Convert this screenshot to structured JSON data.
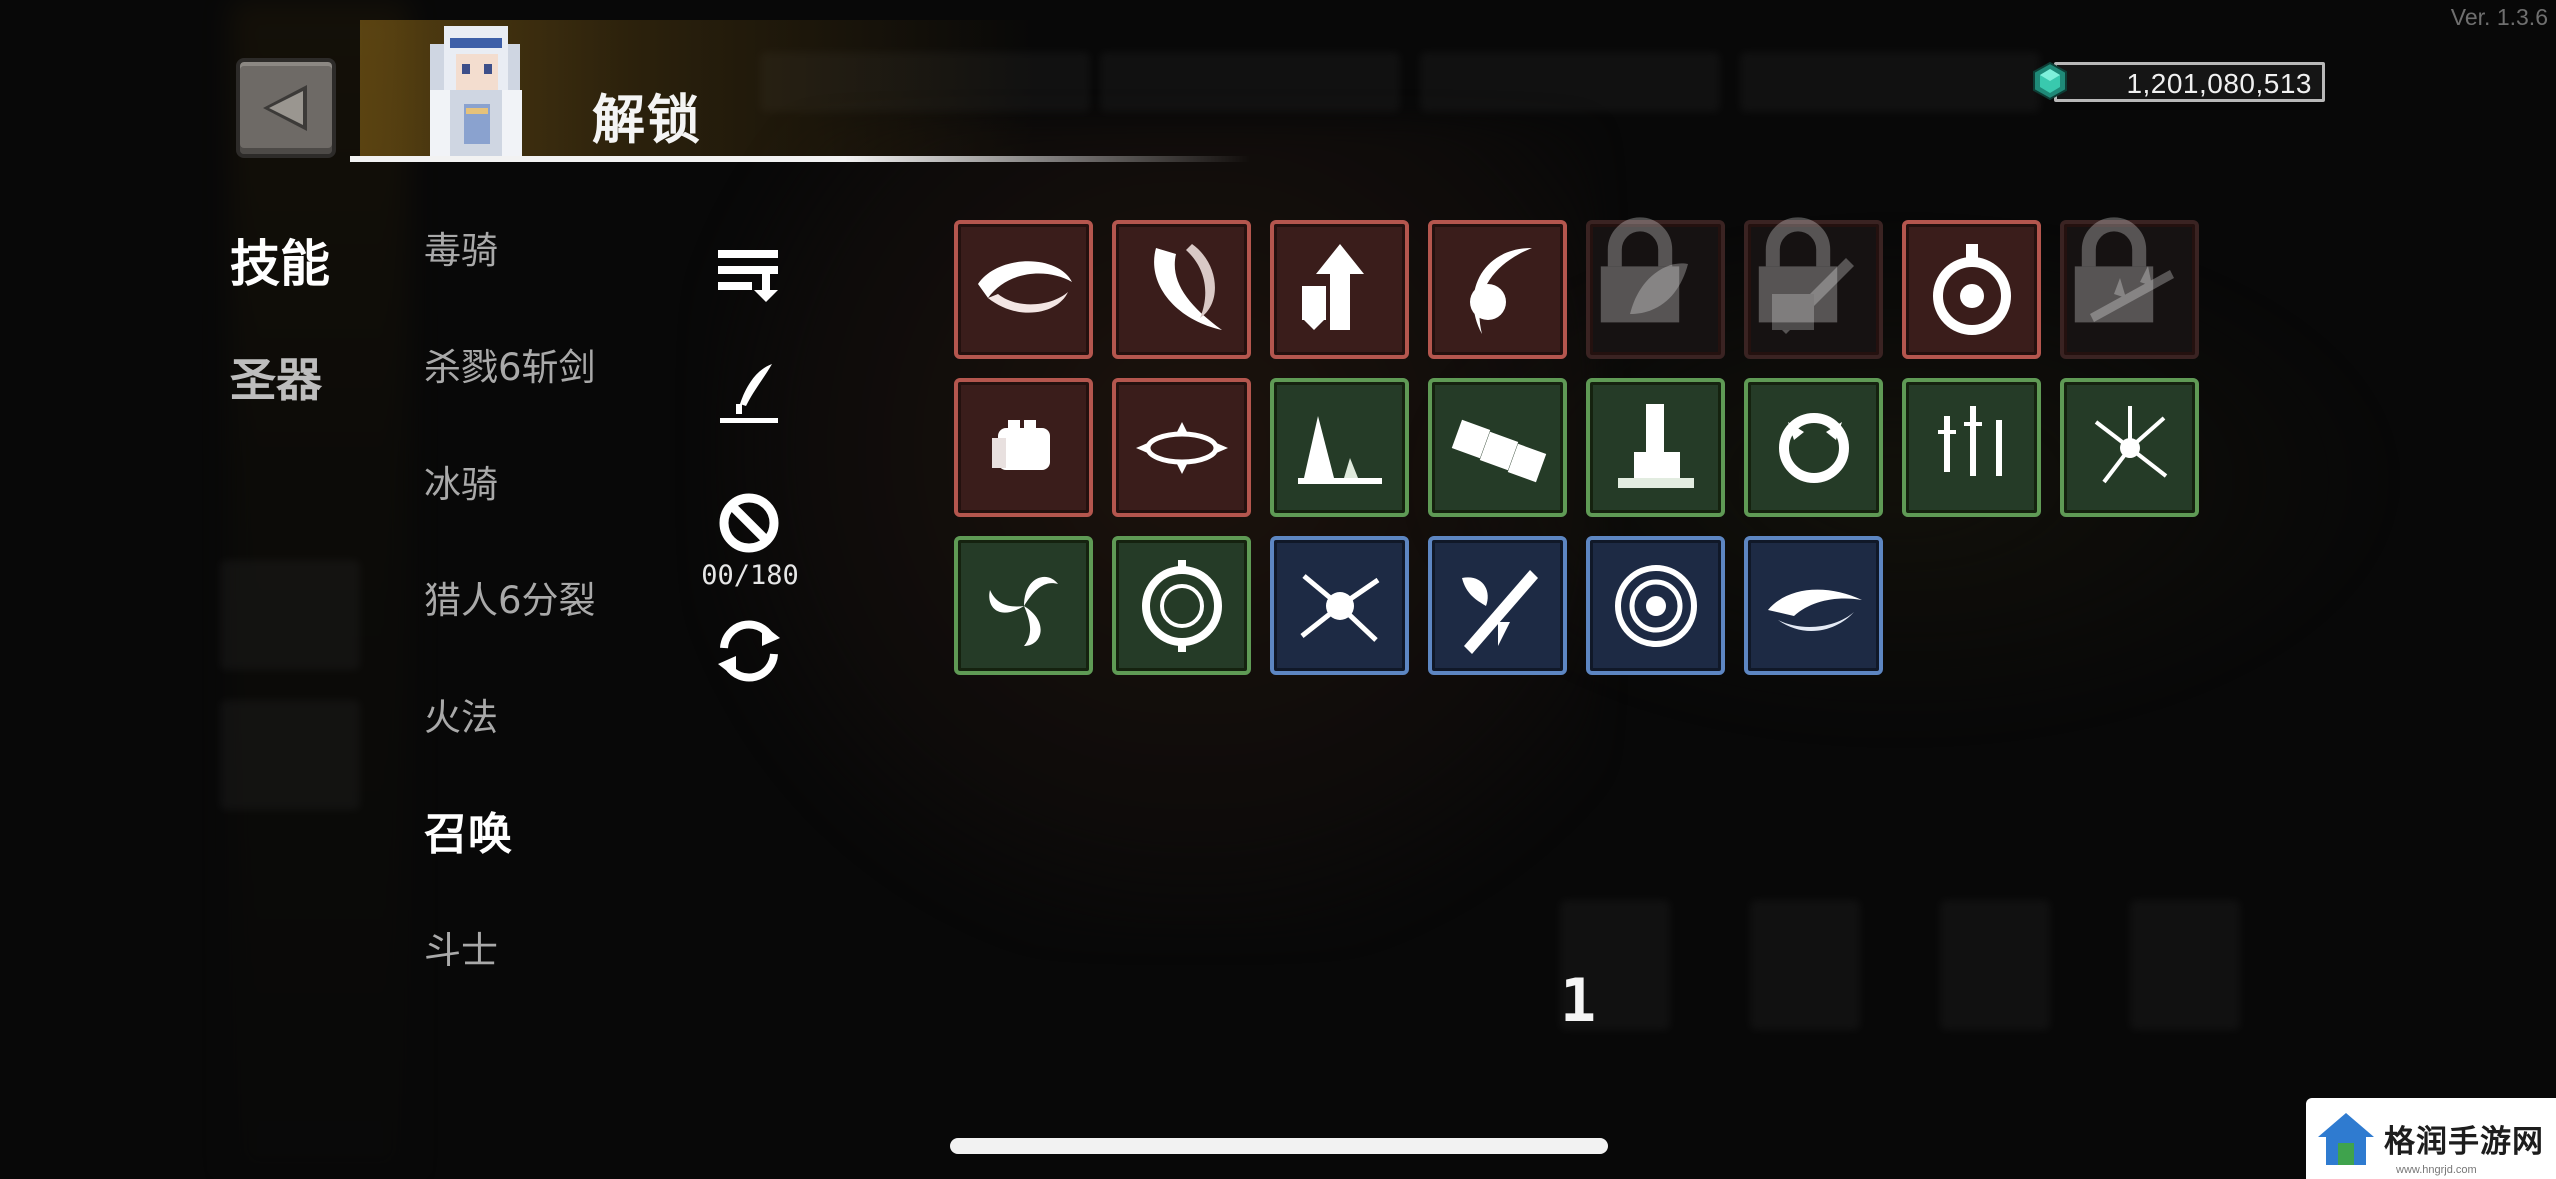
{
  "version": "Ver. 1.3.6",
  "header": {
    "title": "解锁",
    "currency_value": "1,201,080,513"
  },
  "tabs": [
    {
      "label": "技能",
      "active": true
    },
    {
      "label": "圣器",
      "active": false
    }
  ],
  "builds": [
    {
      "label": "毒骑",
      "active": false
    },
    {
      "label": "杀戮6斩剑",
      "active": false
    },
    {
      "label": "冰骑",
      "active": false
    },
    {
      "label": "猎人6分裂",
      "active": false
    },
    {
      "label": "火法",
      "active": false
    },
    {
      "label": "召唤",
      "active": true
    },
    {
      "label": "斗士",
      "active": false
    }
  ],
  "tools": {
    "sort_icon": "sort-descending-icon",
    "edit_icon": "quill-pen-icon",
    "ban_icon": "ban-icon",
    "ban_count": "00/180",
    "reset_icon": "refresh-icon"
  },
  "skills": [
    {
      "icon": "crescent-slash-icon",
      "rarity": "red",
      "locked": false
    },
    {
      "icon": "swirl-blade-icon",
      "rarity": "red",
      "locked": false
    },
    {
      "icon": "arrow-shield-icon",
      "rarity": "red",
      "locked": false
    },
    {
      "icon": "crescent-moon-icon",
      "rarity": "red",
      "locked": false
    },
    {
      "icon": "feather-icon",
      "rarity": "red",
      "locked": true
    },
    {
      "icon": "frost-sword-icon",
      "rarity": "red",
      "locked": true
    },
    {
      "icon": "target-orb-icon",
      "rarity": "red",
      "locked": false
    },
    {
      "icon": "thorn-branch-icon",
      "rarity": "red",
      "locked": true
    },
    {
      "icon": "fist-icon",
      "rarity": "red",
      "locked": false
    },
    {
      "icon": "burst-ring-icon",
      "rarity": "red",
      "locked": false
    },
    {
      "icon": "ground-spike-icon",
      "rarity": "green",
      "locked": false
    },
    {
      "icon": "dice-chain-icon",
      "rarity": "green",
      "locked": false
    },
    {
      "icon": "totem-icon",
      "rarity": "green",
      "locked": false
    },
    {
      "icon": "claw-orb-icon",
      "rarity": "green",
      "locked": false
    },
    {
      "icon": "dagger-rain-icon",
      "rarity": "green",
      "locked": false
    },
    {
      "icon": "shatter-icon",
      "rarity": "green",
      "locked": false
    },
    {
      "icon": "triskelion-icon",
      "rarity": "green",
      "locked": false
    },
    {
      "icon": "rune-ring-icon",
      "rarity": "green",
      "locked": false
    },
    {
      "icon": "spider-burst-icon",
      "rarity": "blue",
      "locked": false
    },
    {
      "icon": "axe-sword-icon",
      "rarity": "blue",
      "locked": false
    },
    {
      "icon": "vortex-icon",
      "rarity": "blue",
      "locked": false
    },
    {
      "icon": "wave-slash-icon",
      "rarity": "blue",
      "locked": false
    }
  ],
  "page_number": "1",
  "watermark": {
    "text": "格润手游网",
    "sub": "www.hngrjd.com"
  }
}
